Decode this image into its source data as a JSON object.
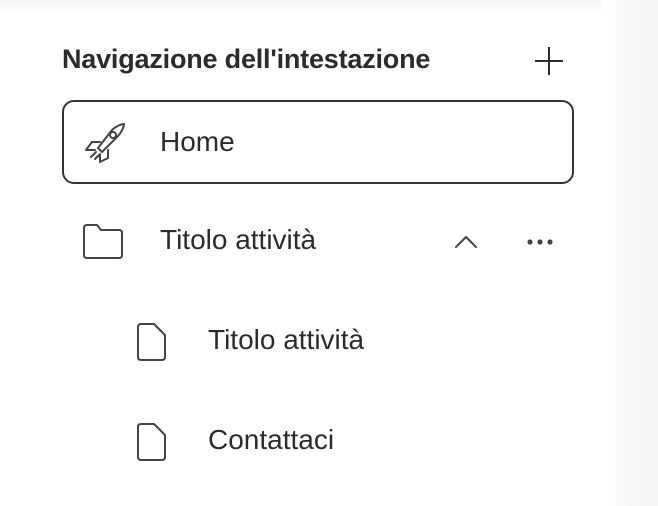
{
  "panel": {
    "title": "Navigazione dell'intestazione"
  },
  "nav": {
    "items": [
      {
        "label": "Home",
        "icon": "rocket-icon",
        "active": true
      },
      {
        "label": "Titolo attività",
        "icon": "folder-icon",
        "expanded": true
      },
      {
        "label": "Titolo attività",
        "icon": "page-icon",
        "level": 2
      },
      {
        "label": "Contattaci",
        "icon": "page-icon",
        "level": 2
      }
    ]
  }
}
